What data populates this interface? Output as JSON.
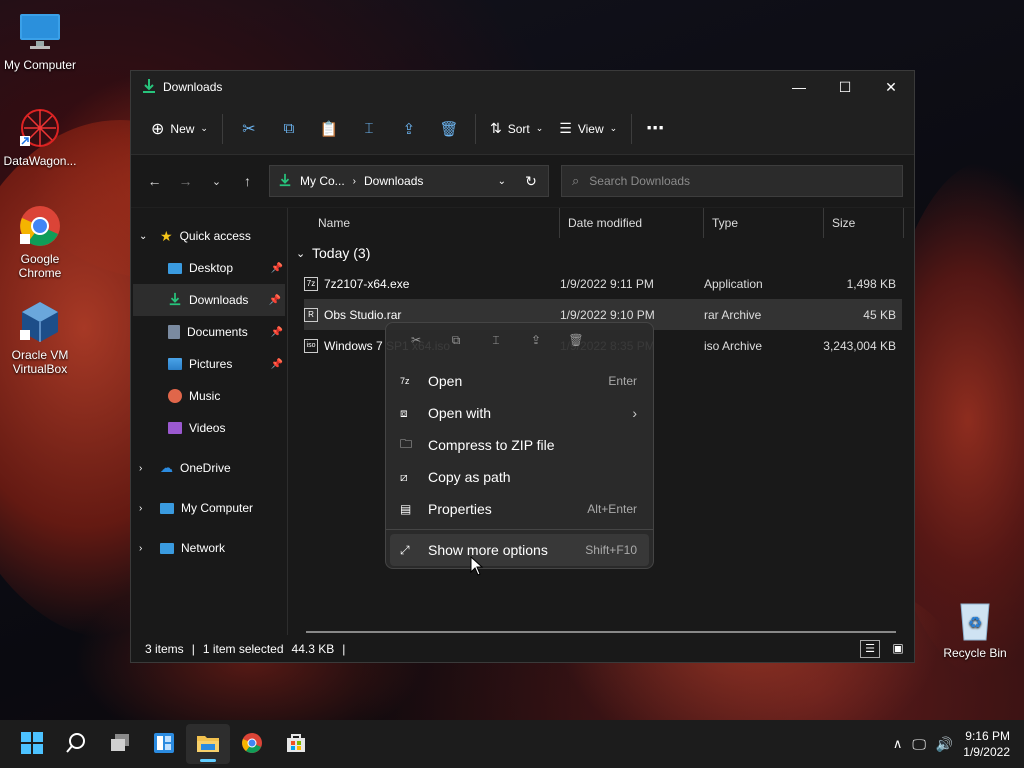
{
  "colors": {
    "accent": "#60cdff",
    "download_green": "#27c47c",
    "window_bg": "#202020"
  },
  "desktop": {
    "icons": [
      {
        "label": "My Computer",
        "icon": "monitor-icon"
      },
      {
        "label": "DataWagon...",
        "icon": "datawagon-icon"
      },
      {
        "label": "Google Chrome",
        "icon": "chrome-icon"
      },
      {
        "label": "Oracle VM VirtualBox",
        "icon": "virtualbox-icon"
      },
      {
        "label": "Recycle Bin",
        "icon": "recycle-bin-icon"
      }
    ]
  },
  "window": {
    "title": "Downloads",
    "toolbar": {
      "new_label": "New",
      "sort_label": "Sort",
      "view_label": "View"
    },
    "address": {
      "crumb1": "My Co...",
      "crumb2": "Downloads"
    },
    "search": {
      "placeholder": "Search Downloads"
    },
    "nav": {
      "quick_access": "Quick access",
      "items": [
        {
          "label": "Desktop",
          "pinned": true
        },
        {
          "label": "Downloads",
          "pinned": true
        },
        {
          "label": "Documents",
          "pinned": true
        },
        {
          "label": "Pictures",
          "pinned": true
        },
        {
          "label": "Music",
          "pinned": false
        },
        {
          "label": "Videos",
          "pinned": false
        }
      ],
      "onedrive": "OneDrive",
      "my_computer": "My Computer",
      "network": "Network"
    },
    "columns": {
      "name": "Name",
      "date": "Date modified",
      "type": "Type",
      "size": "Size"
    },
    "group": "Today (3)",
    "files": [
      {
        "name": "7z2107-x64.exe",
        "date": "1/9/2022 9:11 PM",
        "type": "Application",
        "size": "1,498 KB"
      },
      {
        "name": "Obs Studio.rar",
        "date": "1/9/2022 9:10 PM",
        "type": "rar Archive",
        "size": "45 KB"
      },
      {
        "name": "Windows 7 SP1 x64.iso",
        "date": "1/9/2022 8:35 PM",
        "type": "iso Archive",
        "size": "3,243,004 KB"
      }
    ],
    "status": {
      "items": "3 items",
      "selected": "1 item selected",
      "size": "44.3 KB"
    }
  },
  "context_menu": {
    "items": [
      {
        "label": "Open",
        "shortcut": "Enter"
      },
      {
        "label": "Open with",
        "shortcut": ""
      },
      {
        "label": "Compress to ZIP file",
        "shortcut": ""
      },
      {
        "label": "Copy as path",
        "shortcut": ""
      },
      {
        "label": "Properties",
        "shortcut": "Alt+Enter"
      }
    ],
    "more": {
      "label": "Show more options",
      "shortcut": "Shift+F10"
    }
  },
  "taskbar": {
    "time": "9:16 PM",
    "date": "1/9/2022"
  }
}
